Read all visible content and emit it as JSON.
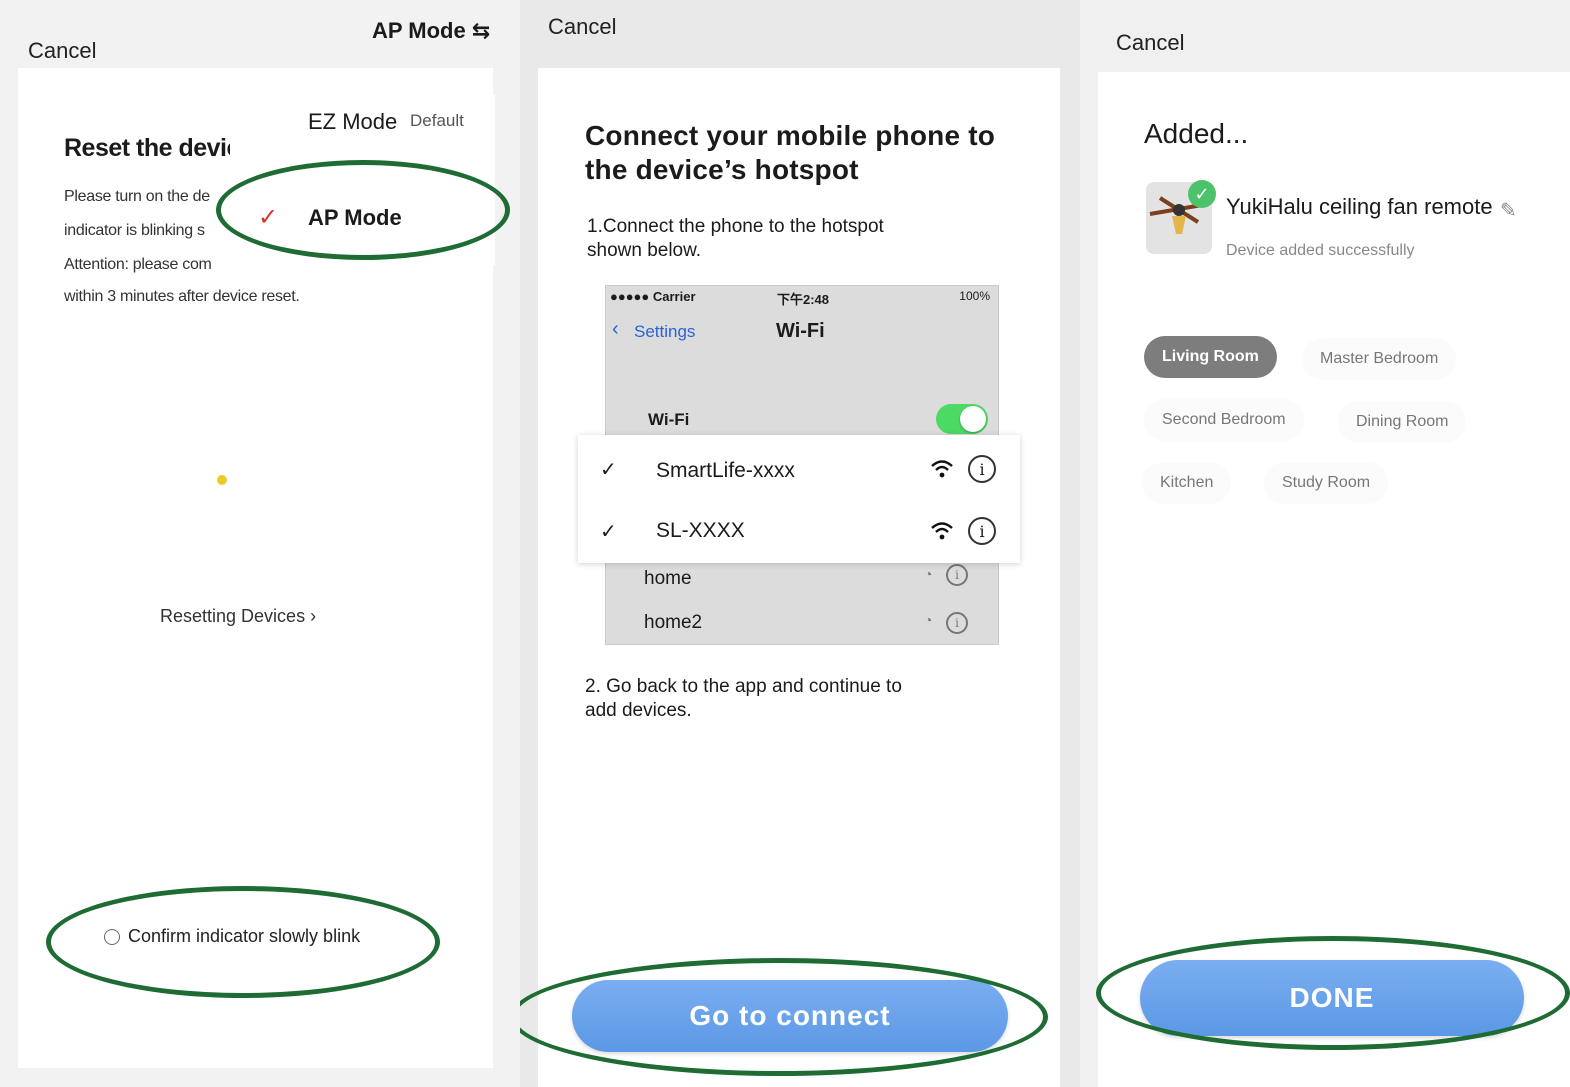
{
  "panel1": {
    "cancel": "Cancel",
    "mode_switch": "AP Mode ⇆",
    "title": "Reset the devic",
    "dropdown": {
      "ez_mode": "EZ Mode",
      "ez_default": "Default",
      "ap_mode": "AP Mode"
    },
    "body_lines": [
      "Please turn on the de",
      "indicator is blinking s",
      "Attention: please com",
      "within 3 minutes after device reset."
    ],
    "resetting_link": "Resetting Devices ›",
    "confirm": "Confirm indicator slowly blink"
  },
  "panel2": {
    "cancel": "Cancel",
    "title_line1": "Connect your mobile phone to",
    "title_line2": "the device’s hotspot",
    "step1_line1": "1.Connect the phone to the hotspot",
    "step1_line2": "shown below.",
    "phone": {
      "carrier": "●●●●● Carrier",
      "time": "下午2:48",
      "battery": "100%",
      "back": "Settings",
      "title": "Wi-Fi",
      "wifi_label": "Wi-Fi"
    },
    "networks": [
      {
        "name": "SmartLife-xxxx"
      },
      {
        "name": "SL-XXXX"
      }
    ],
    "other_networks": [
      {
        "name": "home"
      },
      {
        "name": "home2"
      }
    ],
    "step2_line1": "2. Go back to the app and continue to",
    "step2_line2": "add devices.",
    "connect_button": "Go to connect"
  },
  "panel3": {
    "cancel": "Cancel",
    "title": "Added...",
    "device_name": "YukiHalu ceiling fan remote",
    "device_status": "Device added successfully",
    "rooms": [
      "Living Room",
      "Master Bedroom",
      "Second Bedroom",
      "Dining Room",
      "Kitchen",
      "Study Room"
    ],
    "selected_room": "Living Room",
    "done_button": "DONE"
  },
  "colors": {
    "button_blue": "#5c98e6",
    "highlight_oval": "#1e6b34",
    "check_red": "#d9342b",
    "toggle_green": "#4cd964",
    "ios_blue": "#2a62d6"
  }
}
